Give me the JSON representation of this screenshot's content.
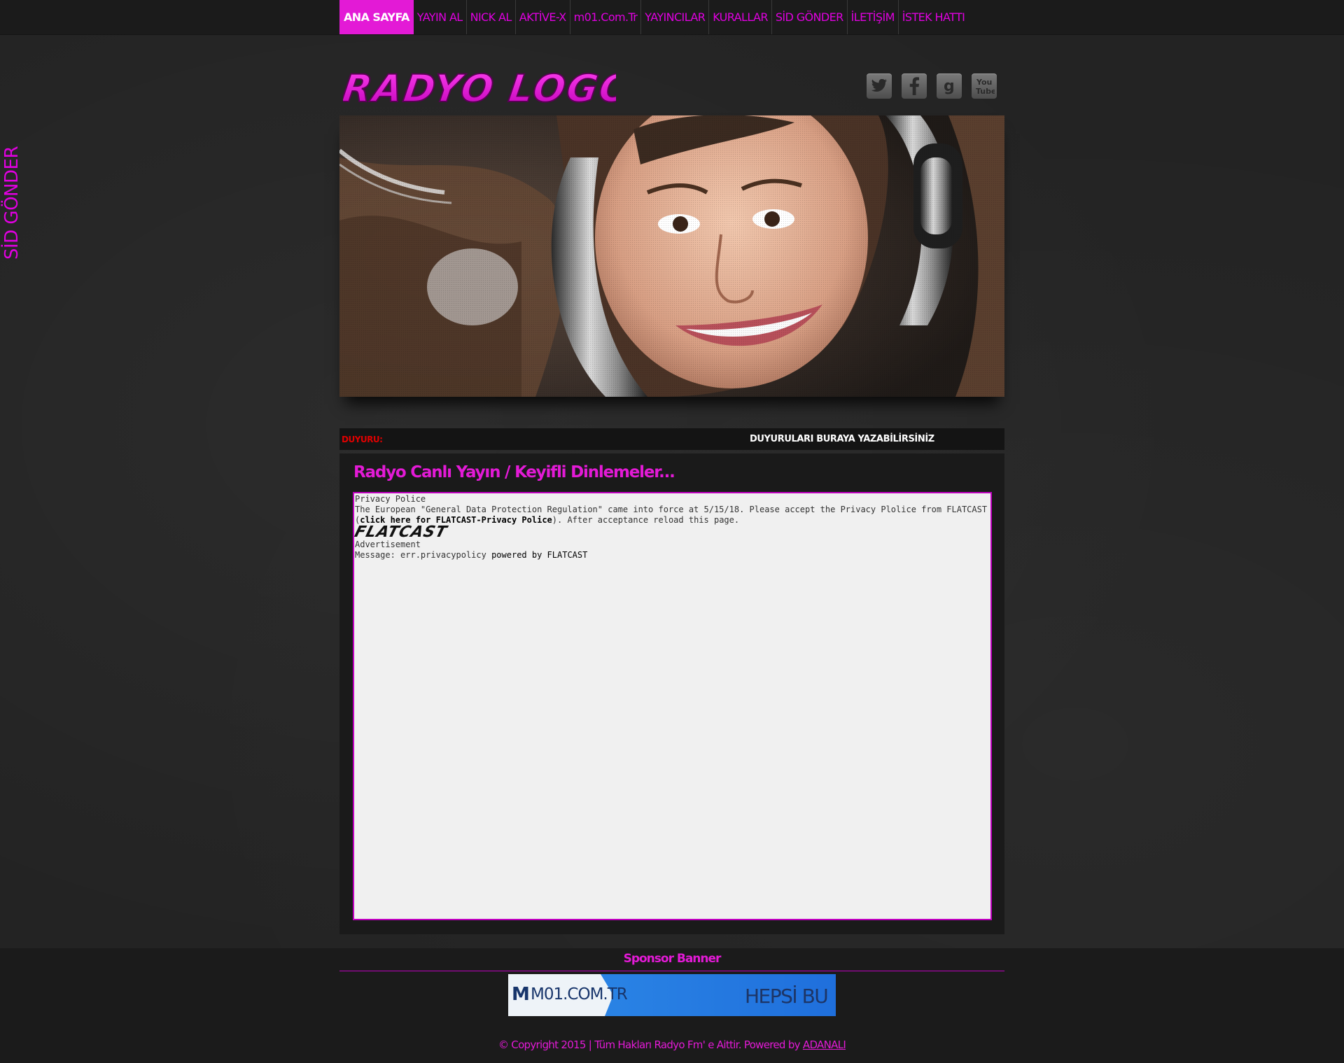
{
  "nav": {
    "items": [
      {
        "label": "ANA SAYFA",
        "active": true
      },
      {
        "label": "YAYIN AL"
      },
      {
        "label": "NICK AL"
      },
      {
        "label": "AKTİVE-X"
      },
      {
        "label": "m01.Com.Tr"
      },
      {
        "label": "YAYINCILAR"
      },
      {
        "label": "KURALLAR"
      },
      {
        "label": "SİD GÖNDER"
      },
      {
        "label": "İLETİŞİM"
      },
      {
        "label": "İSTEK HATTI"
      }
    ]
  },
  "side_tab": {
    "label": "SİD GÖNDER"
  },
  "logo": {
    "text": "RADYO LOGO"
  },
  "social": [
    {
      "name": "twitter-icon",
      "glyph": "t"
    },
    {
      "name": "facebook-icon",
      "glyph": "f"
    },
    {
      "name": "google-icon",
      "glyph": "g"
    },
    {
      "name": "youtube-icon",
      "glyph": "You Tube"
    }
  ],
  "announcement": {
    "label": "DUYURU:",
    "text": "DUYURULARI BURAYA YAZABİLİRSİNİZ"
  },
  "content": {
    "title": "Radyo Canlı Yayın / Keyifli Dinlemeler...",
    "player": {
      "heading": "Privacy Police",
      "line1_pre": "The European \"General Data Protection Regulation\" came into force at 5/15/18. Please accept the Privacy Plolice from FLATCAST (",
      "line1_link": "click here for FLATCAST-Privacy Police",
      "line1_post": "). After acceptance reload this page.",
      "logo": "FLATCAST",
      "advert": "Advertisement",
      "message_pre": "Message: err.privacypolicy ",
      "message_post": "powered by FLATCAST"
    }
  },
  "sponsor": {
    "title": "Sponsor Banner",
    "banner_brand": "M01.COM.TR",
    "banner_logo": "M",
    "banner_tagline": "HEPSİ BU"
  },
  "footer": {
    "text": "© Copyright 2015 | Tüm Hakları Radyo Fm' e Aittir. Powered by ",
    "link": "ADANALI"
  },
  "colors": {
    "accent": "#e31ad6",
    "alert": "#e00000",
    "background": "#232323"
  }
}
